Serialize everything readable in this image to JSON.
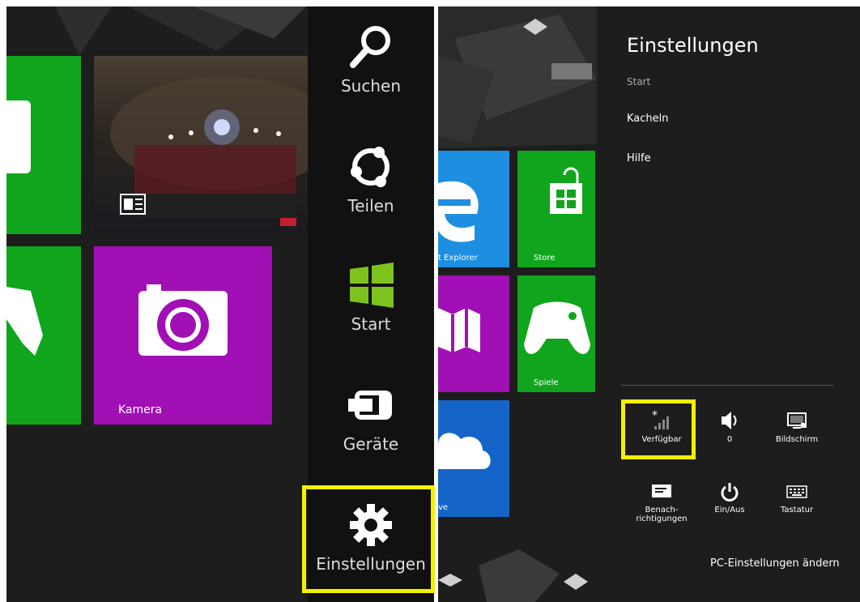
{
  "left_screen": {
    "tiles": [
      {
        "label": "Kamera"
      }
    ]
  },
  "charms": {
    "items": [
      {
        "label": "Suchen",
        "icon": "search-icon"
      },
      {
        "label": "Teilen",
        "icon": "share-icon"
      },
      {
        "label": "Start",
        "icon": "windows-logo-icon"
      },
      {
        "label": "Geräte",
        "icon": "devices-icon"
      },
      {
        "label": "Einstellungen",
        "icon": "gear-icon"
      }
    ]
  },
  "right_screen": {
    "tiles": [
      {
        "label": "t Explorer",
        "color": "#1e8fe0"
      },
      {
        "label": "Store",
        "color": "#10a51c"
      },
      {
        "label": "Spiele",
        "color": "#10a51c"
      },
      {
        "label": "ve",
        "color": "#1565c8"
      }
    ]
  },
  "settings_pane": {
    "title": "Einstellungen",
    "subtitle": "Start",
    "items": [
      "Kacheln",
      "Hilfe"
    ],
    "quick_settings": [
      {
        "label": "Verfügbar",
        "icon": "network-icon"
      },
      {
        "label": "0",
        "icon": "volume-icon"
      },
      {
        "label": "Bildschirm",
        "icon": "screen-icon"
      },
      {
        "label": "Benach-\nrichtigungen",
        "icon": "notifications-icon"
      },
      {
        "label": "Ein/Aus",
        "icon": "power-icon"
      },
      {
        "label": "Tastatur",
        "icon": "keyboard-icon"
      }
    ],
    "footer_link": "PC-Einstellungen ändern"
  },
  "colors": {
    "green": "#10a51c",
    "purple": "#a010b4",
    "highlight": "#f5f000",
    "background": "#1d1d1d"
  }
}
